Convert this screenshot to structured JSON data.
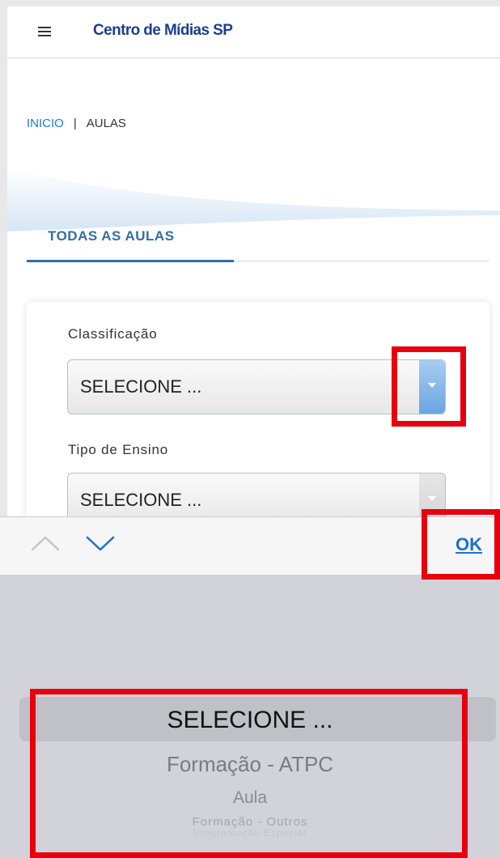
{
  "header": {
    "brand": "Centro de Mídias SP"
  },
  "breadcrumb": {
    "home": "INICIO",
    "separator": "|",
    "current": "AULAS"
  },
  "tabs": [
    {
      "label": "TODAS AS AULAS",
      "active": true
    }
  ],
  "form": {
    "fields": [
      {
        "label": "Classificação",
        "value": "SELECIONE ..."
      },
      {
        "label": "Tipo de Ensino",
        "value": "SELECIONE ..."
      }
    ]
  },
  "toolbar": {
    "prev_icon": "chevron-up-icon",
    "next_icon": "chevron-down-icon",
    "done_label": "OK"
  },
  "picker": {
    "options": [
      "SELECIONE ...",
      "Formação - ATPC",
      "Aula",
      "Formação - Outros",
      "Programação Especial"
    ],
    "selected_index": 0
  },
  "colors": {
    "brand": "#1a3f8f",
    "accent": "#2f6fa6",
    "link": "#1e7bd6",
    "highlight": "#e8000f"
  }
}
